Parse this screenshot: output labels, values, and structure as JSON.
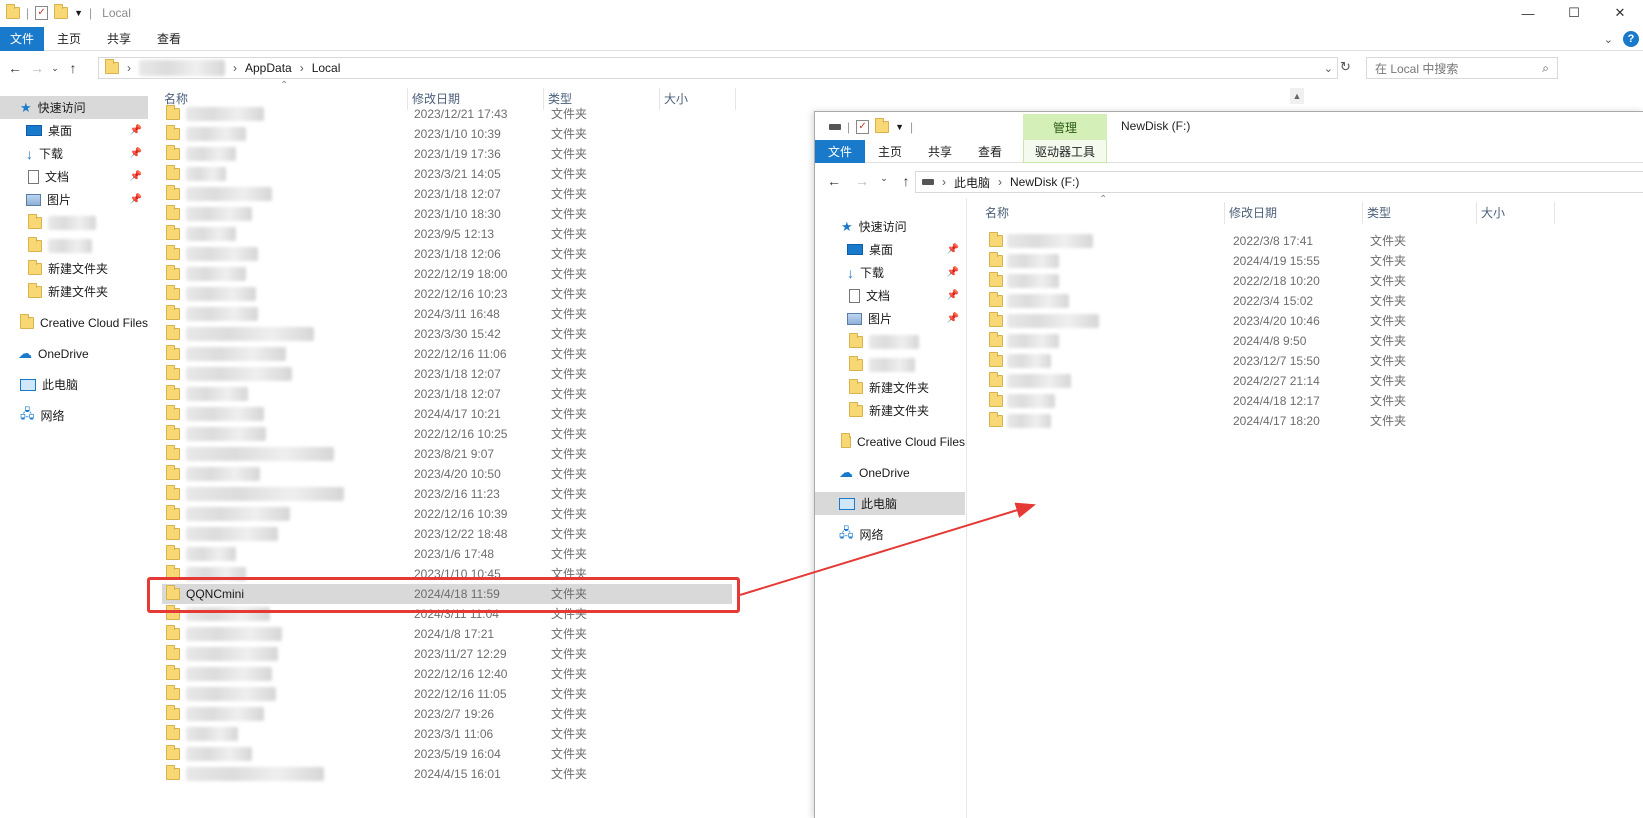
{
  "left_window": {
    "title": "Local",
    "ribbon_tabs": [
      "文件",
      "主页",
      "共享",
      "查看"
    ],
    "breadcrumb": [
      "AppData",
      "Local"
    ],
    "search_placeholder": "在 Local 中搜索",
    "columns": {
      "name": "名称",
      "date": "修改日期",
      "type": "类型",
      "size": "大小"
    },
    "nav": {
      "quick_access": "快速访问",
      "desktop": "桌面",
      "downloads": "下载",
      "documents": "文档",
      "pictures": "图片",
      "new_folder_1": "新建文件夹",
      "new_folder_2": "新建文件夹",
      "creative_cloud": "Creative Cloud Files",
      "onedrive": "OneDrive",
      "this_pc": "此电脑",
      "network": "网络"
    },
    "rows": [
      {
        "name": "",
        "date": "2023/12/21 17:43",
        "type": "文件夹"
      },
      {
        "name": "",
        "date": "2023/1/10 10:39",
        "type": "文件夹"
      },
      {
        "name": "",
        "date": "2023/1/19 17:36",
        "type": "文件夹"
      },
      {
        "name": "",
        "date": "2023/3/21 14:05",
        "type": "文件夹"
      },
      {
        "name": "",
        "date": "2023/1/18 12:07",
        "type": "文件夹"
      },
      {
        "name": "",
        "date": "2023/1/10 18:30",
        "type": "文件夹"
      },
      {
        "name": "",
        "date": "2023/9/5 12:13",
        "type": "文件夹"
      },
      {
        "name": "",
        "date": "2023/1/18 12:06",
        "type": "文件夹"
      },
      {
        "name": "",
        "date": "2022/12/19 18:00",
        "type": "文件夹"
      },
      {
        "name": "",
        "date": "2022/12/16 10:23",
        "type": "文件夹"
      },
      {
        "name": "",
        "date": "2024/3/11 16:48",
        "type": "文件夹"
      },
      {
        "name": "",
        "date": "2023/3/30 15:42",
        "type": "文件夹"
      },
      {
        "name": "",
        "date": "2022/12/16 11:06",
        "type": "文件夹"
      },
      {
        "name": "",
        "date": "2023/1/18 12:07",
        "type": "文件夹"
      },
      {
        "name": "",
        "date": "2023/1/18 12:07",
        "type": "文件夹"
      },
      {
        "name": "",
        "date": "2024/4/17 10:21",
        "type": "文件夹"
      },
      {
        "name": "",
        "date": "2022/12/16 10:25",
        "type": "文件夹"
      },
      {
        "name": "",
        "date": "2023/8/21 9:07",
        "type": "文件夹"
      },
      {
        "name": "",
        "date": "2023/4/20 10:50",
        "type": "文件夹"
      },
      {
        "name": "",
        "date": "2023/2/16 11:23",
        "type": "文件夹"
      },
      {
        "name": "",
        "date": "2022/12/16 10:39",
        "type": "文件夹"
      },
      {
        "name": "",
        "date": "2023/12/22 18:48",
        "type": "文件夹"
      },
      {
        "name": "",
        "date": "2023/1/6 17:48",
        "type": "文件夹"
      },
      {
        "name": "",
        "date": "2023/1/10 10:45",
        "type": "文件夹"
      },
      {
        "name": "QQNCmini",
        "date": "2024/4/18 11:59",
        "type": "文件夹",
        "highlight": true
      },
      {
        "name": "",
        "date": "2024/3/11 11:04",
        "type": "文件夹"
      },
      {
        "name": "",
        "date": "2024/1/8 17:21",
        "type": "文件夹"
      },
      {
        "name": "",
        "date": "2023/11/27 12:29",
        "type": "文件夹"
      },
      {
        "name": "",
        "date": "2022/12/16 12:40",
        "type": "文件夹"
      },
      {
        "name": "",
        "date": "2022/12/16 11:05",
        "type": "文件夹"
      },
      {
        "name": "",
        "date": "2023/2/7 19:26",
        "type": "文件夹"
      },
      {
        "name": "",
        "date": "2023/3/1 11:06",
        "type": "文件夹"
      },
      {
        "name": "",
        "date": "2023/5/19 16:04",
        "type": "文件夹"
      },
      {
        "name": "",
        "date": "2024/4/15 16:01",
        "type": "文件夹"
      }
    ]
  },
  "right_window": {
    "manage_tab": "管理",
    "title": "NewDisk (F:)",
    "ribbon_tabs": [
      "文件",
      "主页",
      "共享",
      "查看"
    ],
    "drive_tools_tab": "驱动器工具",
    "breadcrumb": [
      "此电脑",
      "NewDisk (F:)"
    ],
    "columns": {
      "name": "名称",
      "date": "修改日期",
      "type": "类型",
      "size": "大小"
    },
    "nav": {
      "quick_access": "快速访问",
      "desktop": "桌面",
      "downloads": "下载",
      "documents": "文档",
      "pictures": "图片",
      "new_folder_1": "新建文件夹",
      "new_folder_2": "新建文件夹",
      "creative_cloud": "Creative Cloud Files",
      "onedrive": "OneDrive",
      "this_pc": "此电脑",
      "network": "网络"
    },
    "rows": [
      {
        "date": "2022/3/8 17:41",
        "type": "文件夹"
      },
      {
        "date": "2024/4/19 15:55",
        "type": "文件夹"
      },
      {
        "date": "2022/2/18 10:20",
        "type": "文件夹"
      },
      {
        "date": "2022/3/4 15:02",
        "type": "文件夹"
      },
      {
        "date": "2023/4/20 10:46",
        "type": "文件夹"
      },
      {
        "date": "2024/4/8 9:50",
        "type": "文件夹"
      },
      {
        "date": "2023/12/7 15:50",
        "type": "文件夹"
      },
      {
        "date": "2024/2/27 21:14",
        "type": "文件夹"
      },
      {
        "date": "2024/4/18 12:17",
        "type": "文件夹"
      },
      {
        "date": "2024/4/17 18:20",
        "type": "文件夹"
      }
    ]
  },
  "colors": {
    "accent": "#1979ca",
    "manage_tab": "#d4f0b8",
    "annotation": "#e53935",
    "selection": "#d9d9d9"
  }
}
